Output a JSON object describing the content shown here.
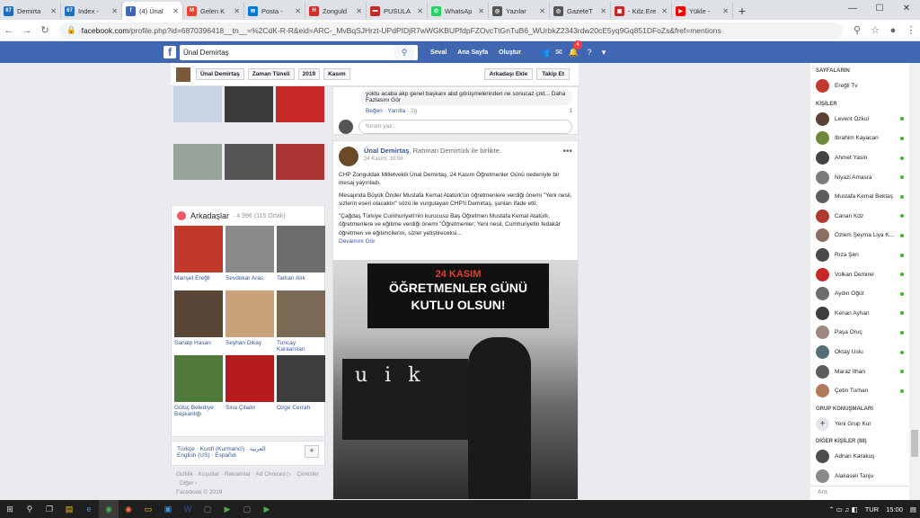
{
  "browser": {
    "tabs": [
      {
        "label": "Demirta",
        "fav": "67",
        "color": "#1a6fbf"
      },
      {
        "label": "Index -",
        "fav": "67",
        "color": "#1a6fbf"
      },
      {
        "label": "(4) Ünal",
        "fav": "f",
        "color": "#4267b2",
        "active": true
      },
      {
        "label": "Gelen K",
        "fav": "M",
        "color": "#ea4335"
      },
      {
        "label": "Posta -",
        "fav": "✉",
        "color": "#0078d4"
      },
      {
        "label": "Zonguld",
        "fav": "H",
        "color": "#d32f2f"
      },
      {
        "label": "PUSULA",
        "fav": "▬",
        "color": "#c62828"
      },
      {
        "label": "WhatsAp",
        "fav": "✆",
        "color": "#25d366"
      },
      {
        "label": "Yazılar",
        "fav": "◎",
        "color": "#555555"
      },
      {
        "label": "GazeteT",
        "fav": "◎",
        "color": "#555555"
      },
      {
        "label": "- Kdz.Ere",
        "fav": "▣",
        "color": "#c62828"
      },
      {
        "label": "Yükle -",
        "fav": "▶",
        "color": "#ff0000"
      }
    ],
    "new_tab": "+",
    "url_host": "facebook.com",
    "url_path": "/profile.php?id=6870396418__tn__=%2CdK-R-R&eid=ARC-_MvBqSJHrzt-UPdPIDjR7wWGKBUPfdpFZOvcTtGnTuB6_WUrbkZ2343rdw20cE5yq9Gq851DFoZs&fref=mentions"
  },
  "fb": {
    "logo": "f",
    "search_value": "Ünal Demirtaş",
    "user": "Seval",
    "home": "Ana Sayfa",
    "create": "Oluştur",
    "notif_count": "4"
  },
  "subnav": {
    "name": "Ünal Demirtaş",
    "timeline": "Zaman Tüneli",
    "year": "2019",
    "month": "Kasım",
    "add_friend": "Arkadaşı Ekle",
    "follow": "Takip Et"
  },
  "friends": {
    "title": "Arkadaşlar",
    "count": "· 4.996 (115 Ortak)",
    "items": [
      {
        "name": "Manşet Ereğli",
        "color": "#c0392b"
      },
      {
        "name": "Sevdekar Aras",
        "color": "#8a8a8a"
      },
      {
        "name": "Tarkan Alık",
        "color": "#6d6d6d"
      },
      {
        "name": "Sanalp Hasan",
        "color": "#5a4636"
      },
      {
        "name": "Seyhan Dikay",
        "color": "#c9a27a"
      },
      {
        "name": "Tuncay Karaarslan",
        "color": "#7a6a55"
      },
      {
        "name": "Gülüç Belediye Başkanlığı",
        "color": "#4f7a3a"
      },
      {
        "name": "Sina Çiladır",
        "color": "#b71c1c"
      },
      {
        "name": "Ozge Cerrah",
        "color": "#3e3e3e"
      }
    ]
  },
  "languages": {
    "line1": "Türkçe · Kurdî (Kurmancî) · العربية",
    "line2": "English (US) · Español",
    "plus": "+"
  },
  "footer": {
    "links": "Gizlilik · Koşullar · Reklamlar · Ad Choices ▷ · Çerezler",
    "more": "· Diğer ›",
    "copy": "Facebook © 2019"
  },
  "post1": {
    "snippet": "yoktu acaba akp genel başkanı abd görüşmelerinden ne sonucaz çıkt... Daha Fazlasını Gör",
    "like": "Beğen",
    "reply": "Yanıtla",
    "time": "2g",
    "reactions": "1",
    "comment_placeholder": "Yorum yaz..."
  },
  "post2": {
    "author": "Ünal Demirtaş",
    "with_text": "Rahman Demirtürk ile birlikte.",
    "with_prefix": ", ",
    "date": "24 Kasım, 10:56 · ",
    "dots": "•••",
    "p1": "CHP Zonguldak Milletvekili Ünal Demirtaş, 24 Kasım Öğretmenler Günü nedeniyle bir mesaj yayınladı.",
    "p2": "Mesajında Büyük Önder Mustafa Kemal Atatürk'ün öğretmenlere verdiği önemi \"Yeni nesil, sizlerin eseri olacaktır\" sözü ile vurgulayan CHP'li Demirtaş, şunları ifade etti;",
    "p3": "\"Çağdaş Türkiye Cumhuriyeti'nin kurucusu Baş Öğretmen Mustafa Kemal Atatürk, öğretmenlere ve eğitime verdiği önemi \"Öğretmenler; Yeni nesil, Cumhuriyetin fedakâr öğretmen ve eğitimcilerini, sizler yetiştireceksi...",
    "more": "Devamını Gör",
    "banner1": "24 KASIM",
    "banner2": "ÖĞRETMENLER GÜNÜ",
    "banner3": "KUTLU OLSUN!",
    "board": "u i k"
  },
  "sidebar": {
    "pages_title": "SAYFALARIN",
    "pages": [
      {
        "name": "Ereğli Tv",
        "color": "#c0392b"
      }
    ],
    "people_title": "KİŞİLER",
    "contacts": [
      {
        "name": "Levent Özkul",
        "color": "#5d4037"
      },
      {
        "name": "İbrahim Kayacan",
        "color": "#6d8a3a"
      },
      {
        "name": "Ahmet Yasin",
        "color": "#444444"
      },
      {
        "name": "Niyazi Amasra",
        "color": "#7b7b7b"
      },
      {
        "name": "Mustafa Kemal Bektaş",
        "color": "#5c5c5c"
      },
      {
        "name": "Canan Kdz",
        "color": "#b03a2e"
      },
      {
        "name": "Özlem Şeyma Liya K...",
        "color": "#8d6e63"
      },
      {
        "name": "Rıza Şen",
        "color": "#4a4a4a"
      },
      {
        "name": "Volkan Demirel",
        "color": "#c62828"
      },
      {
        "name": "Aydın Öğüt",
        "color": "#6d6d6d"
      },
      {
        "name": "Kenan Ayhan",
        "color": "#3e3e3e"
      },
      {
        "name": "Paşa Oruç",
        "color": "#a1887f"
      },
      {
        "name": "Oktay Uslu",
        "color": "#546e7a"
      },
      {
        "name": "Maraz İlhan",
        "color": "#5d5d5d"
      },
      {
        "name": "Çetin Turhan",
        "color": "#b07a5a"
      }
    ],
    "groups_title": "GRUP KONUŞMALARI",
    "new_group": "Yeni Grup Kur",
    "others_title": "DİĞER KİŞİLER (88)",
    "others": [
      {
        "name": "Adnan Karakuş",
        "color": "#4e4e4e"
      },
      {
        "name": "Alakaseli Tanju",
        "color": "#8a8a8a"
      }
    ],
    "search_placeholder": "Ara"
  },
  "taskbar": {
    "time": "15:00",
    "lang": "TUR"
  }
}
